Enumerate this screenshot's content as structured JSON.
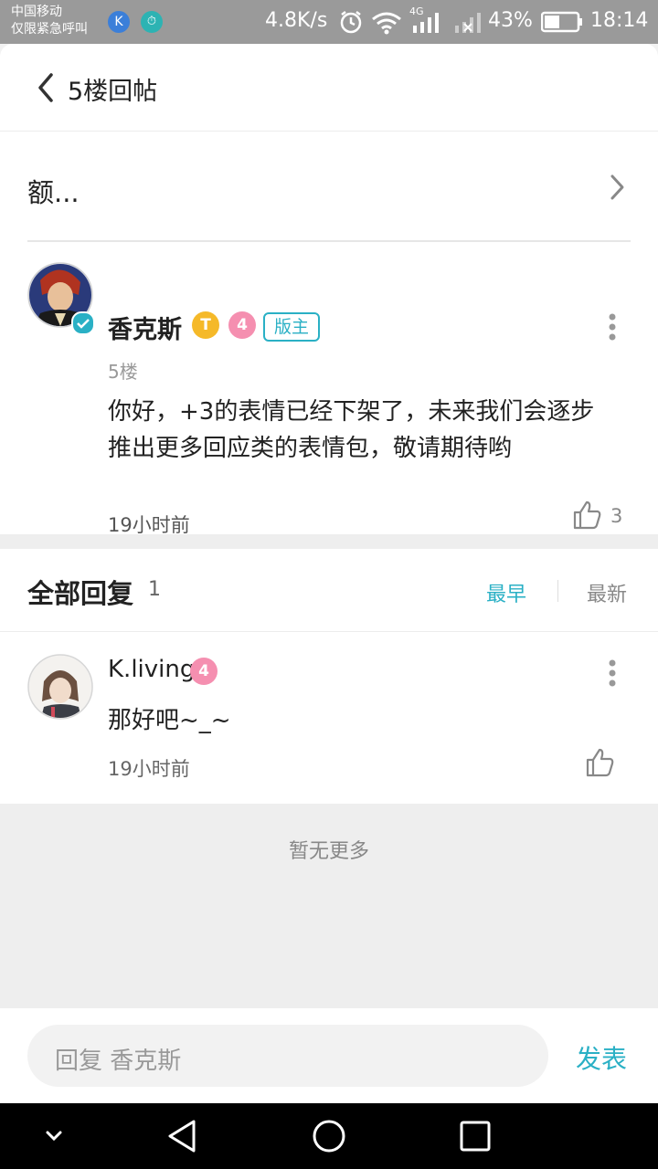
{
  "status_bar": {
    "carrier_line1": "中国移动",
    "carrier_line2": "仅限紧急呼叫",
    "network_speed": "4.8K/s",
    "network_type": "4G",
    "battery_percent": "43%",
    "time": "18:14"
  },
  "header": {
    "title": "5楼回帖"
  },
  "thread": {
    "title": "额..."
  },
  "post": {
    "author": "香克斯",
    "badge_t": "T",
    "level": "4",
    "role_tag": "版主",
    "floor": "5楼",
    "content_line1": "你好，+3的表情已经下架了，未来我们会逐步",
    "content_line2": "推出更多回应类的表情包，敬请期待哟",
    "time": "19小时前",
    "like_count": "3"
  },
  "replies_section": {
    "title": "全部回复",
    "count": "1",
    "sort_earliest": "最早",
    "sort_latest": "最新"
  },
  "replies": [
    {
      "author": "K.living",
      "level": "4",
      "content": "那好吧~_~",
      "time": "19小时前"
    }
  ],
  "no_more": "暂无更多",
  "reply_bar": {
    "placeholder": "回复 香克斯",
    "send_label": "发表"
  },
  "colors": {
    "accent": "#2ab0c5",
    "level_pink": "#f58fb0",
    "gold": "#f5b929"
  }
}
